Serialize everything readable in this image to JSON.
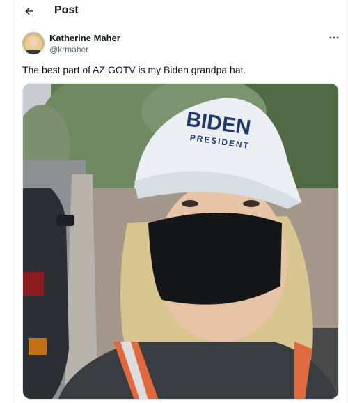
{
  "header": {
    "title": "Post"
  },
  "author": {
    "name": "Katherine Maher",
    "handle": "@krmaher"
  },
  "tweet": {
    "text": "The best part of AZ GOTV is my Biden grandpa hat."
  },
  "photo": {
    "hat_line1": "BIDEN",
    "hat_line2": "PRESIDENT"
  },
  "icons": {
    "back": "arrow-left-icon",
    "more": "more-horizontal-icon"
  },
  "colors": {
    "text_primary": "#0f1419",
    "text_secondary": "#536471",
    "hat_navy": "#1f3a6b",
    "hat_red": "#c8202e"
  }
}
